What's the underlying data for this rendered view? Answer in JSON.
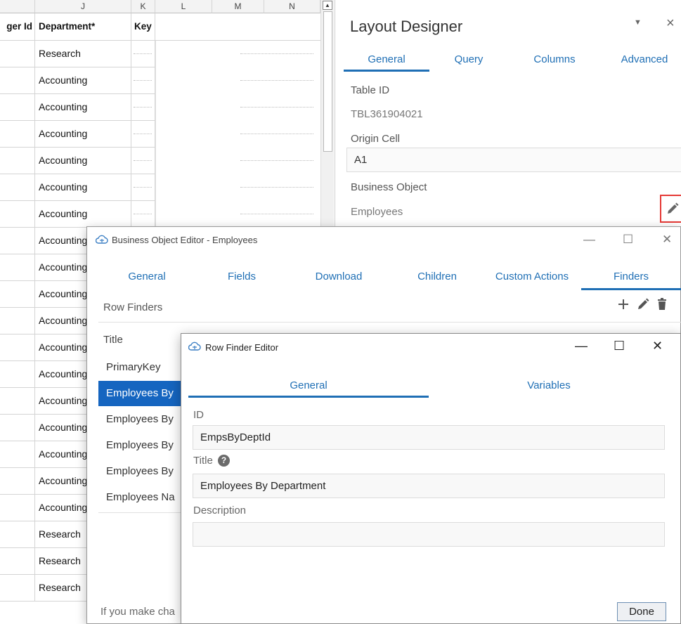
{
  "sheet": {
    "columns": [
      "J",
      "K",
      "L",
      "M",
      "N"
    ],
    "headers": {
      "prev": "ger Id",
      "department": "Department*",
      "key": "Key"
    },
    "departments": [
      "Research",
      "Accounting",
      "Accounting",
      "Accounting",
      "Accounting",
      "Accounting",
      "Accounting",
      "Accounting",
      "Accounting",
      "Accounting",
      "Accounting",
      "Accounting",
      "Accounting",
      "Accounting",
      "Accounting",
      "Accounting",
      "Accounting",
      "Accounting",
      "Research",
      "Research",
      "Research"
    ]
  },
  "layout_designer": {
    "title": "Layout Designer",
    "menu_glyph": "▼",
    "close_glyph": "×",
    "tabs": [
      "General",
      "Query",
      "Columns",
      "Advanced"
    ],
    "active_tab": "General",
    "table_id_label": "Table ID",
    "table_id_value": "TBL361904021",
    "origin_cell_label": "Origin Cell",
    "origin_cell_value": "A1",
    "business_object_label": "Business Object",
    "business_object_value": "Employees",
    "edit_icon": "pencil-icon"
  },
  "business_object_editor": {
    "title": "Business Object Editor - Employees",
    "controls": {
      "minimize": "—",
      "maximize": "☐",
      "close": "✕"
    },
    "tabs": [
      "General",
      "Fields",
      "Download",
      "Children",
      "Custom Actions",
      "Finders"
    ],
    "active_tab": "Finders",
    "row_finders_label": "Row Finders",
    "actions": [
      "add-icon",
      "pencil-icon",
      "trash-icon"
    ],
    "list_header": "Title",
    "finders": [
      "PrimaryKey",
      "Employees By",
      "Employees By",
      "Employees By",
      "Employees By",
      "Employees Na"
    ],
    "selected_index": 1,
    "footer_text": "If you make cha"
  },
  "row_finder_editor": {
    "title": "Row Finder Editor",
    "controls": {
      "minimize": "—",
      "maximize": "☐",
      "close": "✕"
    },
    "tabs": [
      "General",
      "Variables"
    ],
    "active_tab": "General",
    "id_label": "ID",
    "id_value": "EmpsByDeptId",
    "title_label": "Title",
    "help_glyph": "?",
    "title_value": "Employees By Department",
    "description_label": "Description",
    "description_value": "",
    "done_label": "Done"
  },
  "colors": {
    "accent": "#1f6fb5",
    "selection": "#1565c0",
    "highlight": "#e53935"
  }
}
